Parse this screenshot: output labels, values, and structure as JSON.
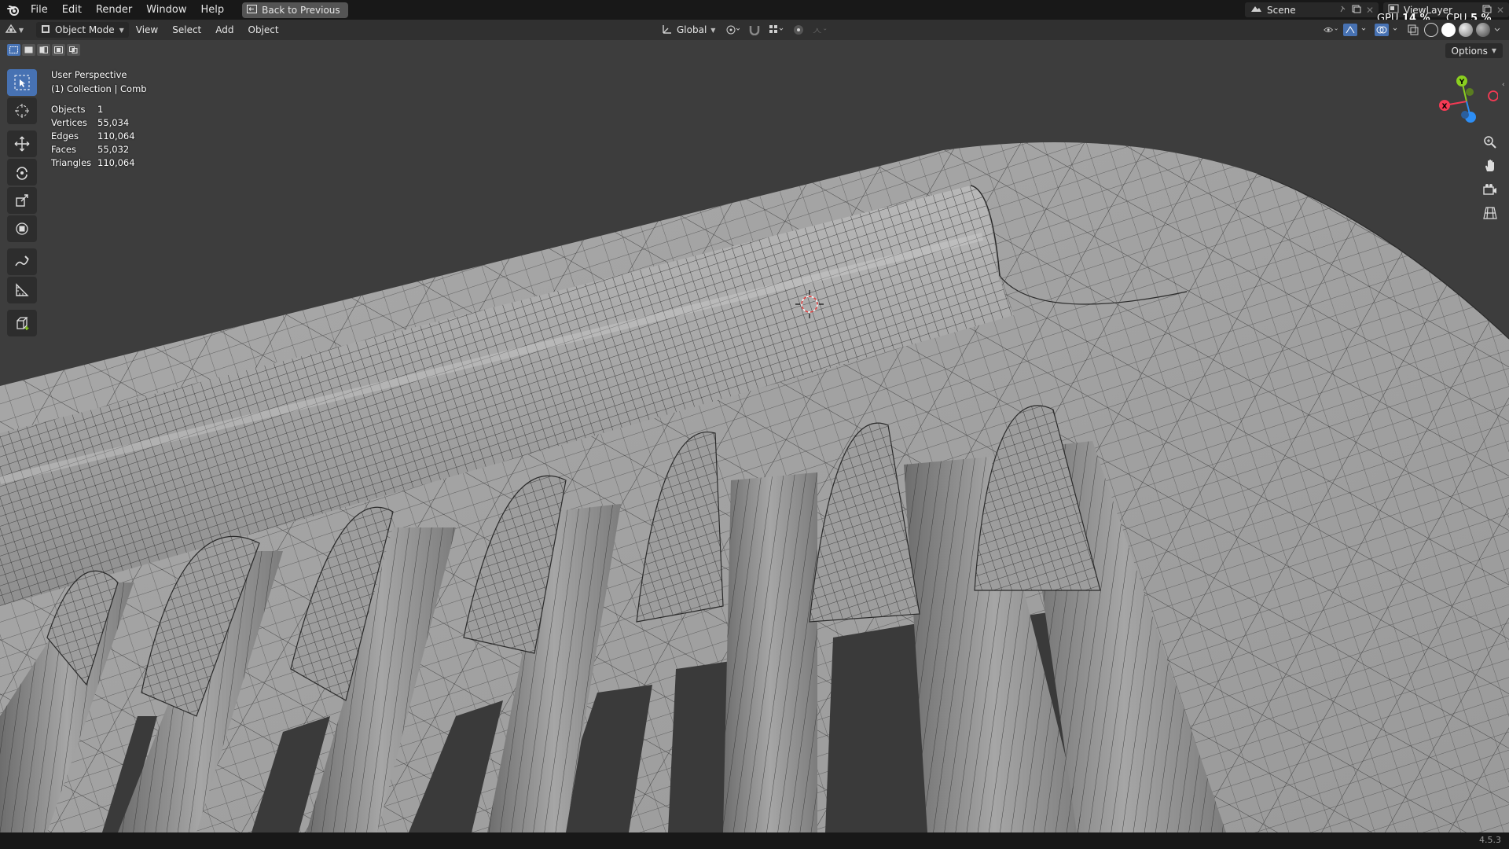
{
  "topbar": {
    "menus": [
      "File",
      "Edit",
      "Render",
      "Window",
      "Help"
    ],
    "back_label": "Back to Previous",
    "scene_name": "Scene",
    "view_layer_name": "ViewLayer",
    "gpu_label": "GPU",
    "gpu_value": "14 %",
    "cpu_label": "CPU",
    "cpu_value": "5 %"
  },
  "header": {
    "mode": "Object Mode",
    "menus": [
      "View",
      "Select",
      "Add",
      "Object"
    ],
    "orientation": "Global",
    "options_label": "Options"
  },
  "overlay": {
    "view_name": "User Perspective",
    "collection": "(1) Collection | Comb",
    "stats": [
      {
        "label": "Objects",
        "value": "1"
      },
      {
        "label": "Vertices",
        "value": "55,034"
      },
      {
        "label": "Edges",
        "value": "110,064"
      },
      {
        "label": "Faces",
        "value": "55,032"
      },
      {
        "label": "Triangles",
        "value": "110,064"
      }
    ]
  },
  "gizmo": {
    "x_label": "X",
    "y_label": "Y",
    "z_label": "Z"
  },
  "status": {
    "version": "4.5.3"
  },
  "colors": {
    "accent": "#4772b3",
    "axis_x": "#f53a54",
    "axis_y": "#8acf1f",
    "axis_z": "#2d8ef5",
    "background": "#3d3d3d",
    "mesh_surface": "#a8a8a8",
    "wire": "#1e1e1e"
  }
}
